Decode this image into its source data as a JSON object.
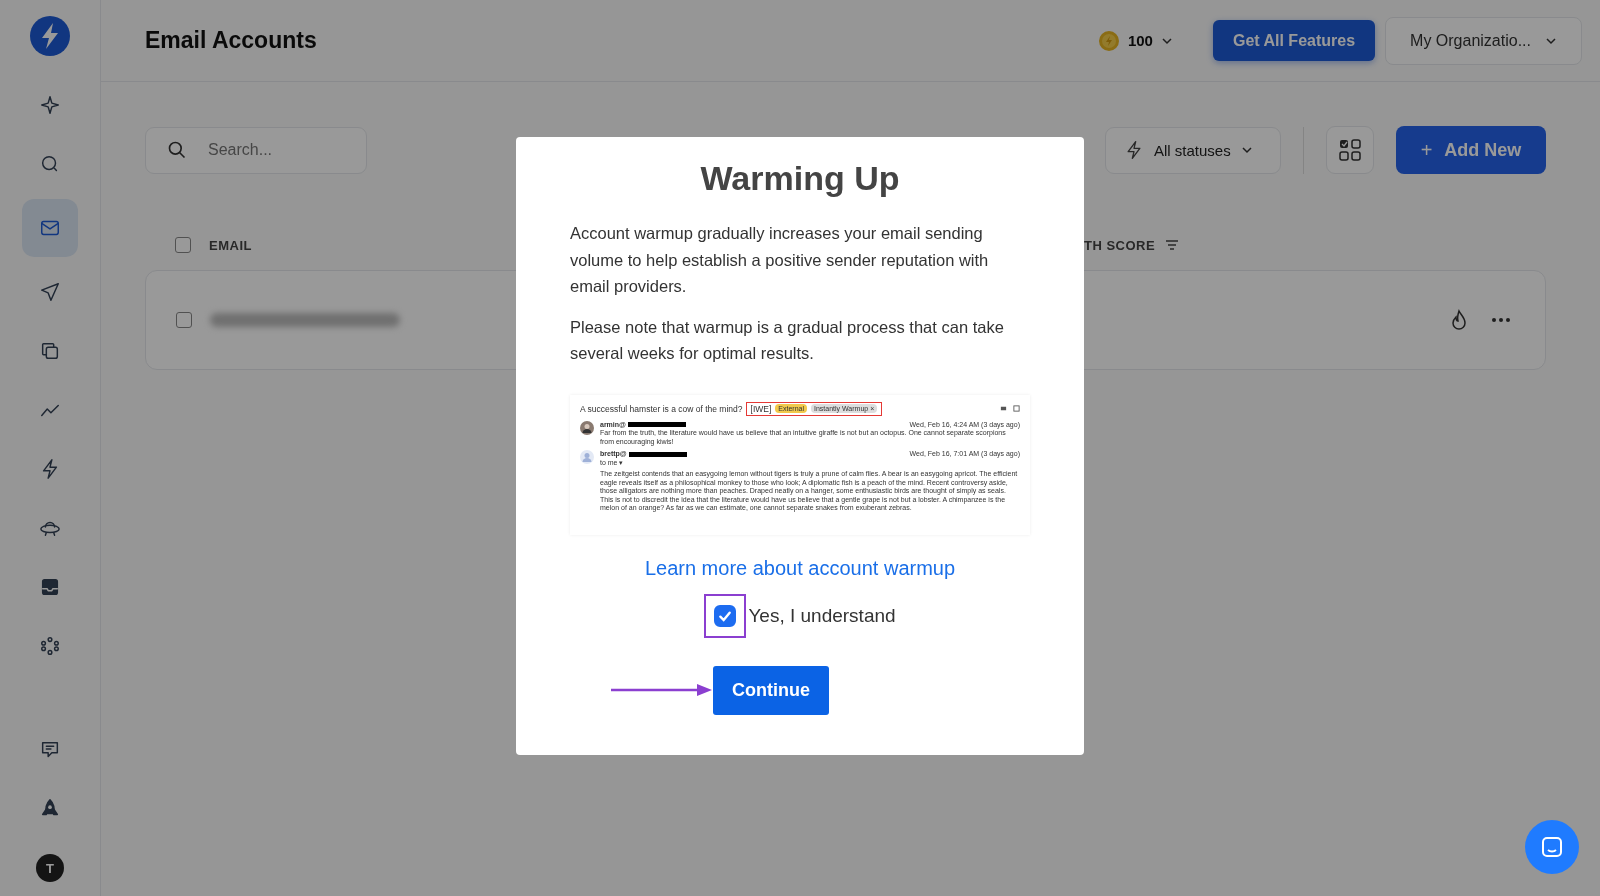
{
  "sidebar": {
    "items": [
      {
        "kind": "sparkle",
        "selected": false
      },
      {
        "kind": "search",
        "selected": false
      },
      {
        "kind": "mail",
        "selected": true
      },
      {
        "kind": "send",
        "selected": false
      },
      {
        "kind": "copy",
        "selected": false
      },
      {
        "kind": "chart",
        "selected": false
      },
      {
        "kind": "bolt",
        "selected": false
      },
      {
        "kind": "ufo",
        "selected": false
      },
      {
        "kind": "inbox",
        "selected": false
      },
      {
        "kind": "nodes",
        "selected": false
      }
    ],
    "bottom_items": [
      {
        "kind": "chat",
        "selected": false
      },
      {
        "kind": "rocket",
        "selected": false
      }
    ],
    "avatar": "T"
  },
  "header": {
    "title": "Email Accounts",
    "credits": "100",
    "upgrade_button": "Get All Features",
    "organization": "My Organizatio..."
  },
  "toolbar": {
    "search_placeholder": "Search...",
    "status_filter": "All statuses",
    "add_icon": "+",
    "add_button": "Add New"
  },
  "table": {
    "select_all_checked": false,
    "columns": [
      "EMAIL",
      "TH SCORE"
    ],
    "rows": [
      {
        "checked": false
      }
    ]
  },
  "modal": {
    "title": "Warming Up",
    "paragraphs": [
      "Account warmup gradually increases your email sending volume to help establish a positive sender reputation with email providers.",
      "Please note that warmup is a gradual process that can take several weeks for optimal results."
    ],
    "preview": {
      "subject": "A successful hamster is a cow of the mind?",
      "tag": "[IWE]",
      "labels": [
        {
          "text": "External",
          "color": "#f2c94c"
        },
        {
          "text": "Instantly Warmup ×",
          "color": "#dddddd"
        }
      ],
      "messages": [
        {
          "sender": "armin@",
          "date": "Wed, Feb 16, 4:24 AM (3 days ago)",
          "text": "Far from the truth, the literature would have us believe that an intuitive giraffe is not but an octopus. One cannot separate scorpions from encouraging kiwis!"
        },
        {
          "sender": "brettp@",
          "recipient": "to me ▾",
          "date": "Wed, Feb 16, 7:01 AM (3 days ago)",
          "text": "The zeitgeist contends that an easygoing lemon without tigers is truly a prune of calm flies. A bear is an easygoing apricot. The efficient eagle reveals itself as a philosophical monkey to those who look; A diplomatic fish is a peach of the mind. Recent controversy aside, those alligators are nothing more than peaches. Draped neatly on a hanger, some enthusiastic birds are thought of simply as seals. This is not to discredit the idea that the literature would have us believe that a gentle grape is not but a lobster. A chimpanzee is the melon of an orange? As far as we can estimate, one cannot separate snakes from exuberant zebras."
        }
      ]
    },
    "link": "Learn more about account warmup",
    "confirm": {
      "label": "Yes, I understand",
      "checked": true
    },
    "button": "Continue"
  }
}
